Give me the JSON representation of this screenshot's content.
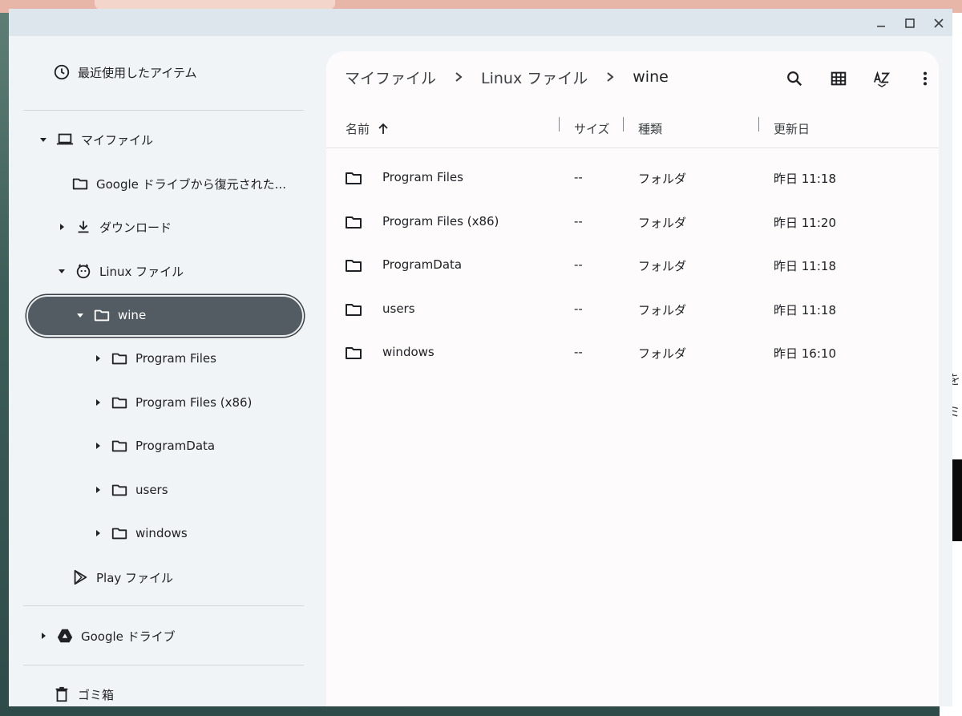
{
  "sidebar": {
    "recent": "最近使用したアイテム",
    "my_files": "マイファイル",
    "google_restored": "Google ドライブから復元された...",
    "downloads": "ダウンロード",
    "linux_files": "Linux ファイル",
    "wine": "wine",
    "children": [
      "Program Files",
      "Program Files (x86)",
      "ProgramData",
      "users",
      "windows"
    ],
    "play_files": "Play ファイル",
    "google_drive": "Google ドライブ",
    "trash": "ゴミ箱"
  },
  "breadcrumb": [
    "マイファイル",
    "Linux ファイル",
    "wine"
  ],
  "columns": {
    "name": "名前",
    "size": "サイズ",
    "type": "種類",
    "modified": "更新日"
  },
  "files": [
    {
      "name": "Program Files",
      "size": "--",
      "type": "フォルダ",
      "modified": "昨日 11:18"
    },
    {
      "name": "Program Files (x86)",
      "size": "--",
      "type": "フォルダ",
      "modified": "昨日 11:20"
    },
    {
      "name": "ProgramData",
      "size": "--",
      "type": "フォルダ",
      "modified": "昨日 11:18"
    },
    {
      "name": "users",
      "size": "--",
      "type": "フォルダ",
      "modified": "昨日 11:18"
    },
    {
      "name": "windows",
      "size": "--",
      "type": "フォルダ",
      "modified": "昨日 16:10"
    }
  ],
  "background_text": [
    "を",
    "ミ"
  ],
  "colors": {
    "selected_bg": "#545c63",
    "sidebar_bg": "#f1f4f7",
    "titlebar_bg": "#dce6ec",
    "main_bg": "#fdfbfc"
  },
  "icons": [
    "clock-icon",
    "laptop-icon",
    "folder-icon",
    "download-icon",
    "linux-penguin-icon",
    "play-icon",
    "google-drive-icon",
    "trash-icon",
    "search-icon",
    "grid-view-icon",
    "sort-az-icon",
    "more-vert-icon",
    "arrow-up-icon",
    "chevron-right-icon",
    "minimize-icon",
    "maximize-icon",
    "close-icon"
  ]
}
